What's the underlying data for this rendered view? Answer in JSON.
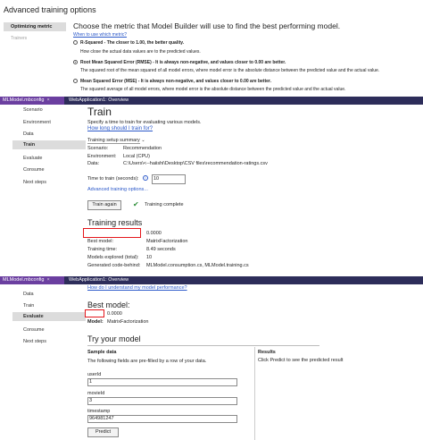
{
  "advanced": {
    "title": "Advanced training options",
    "side_active": "Optimizing metric",
    "side_inactive": "Trainers",
    "heading": "Choose the metric that Model Builder will use to find the best performing model.",
    "link": "When to use which metric?",
    "options": [
      {
        "label": "R-Squared - The closer to 1.00, the better quality.",
        "desc": "How close the actual data values are to the predicted values.",
        "selected": false
      },
      {
        "label": "Root Mean Squared Error (RMSE) - It is always non-negative, and values closer to 0.00 are better.",
        "desc": "The squared root of the mean squared of all model errors, where model error is the absolute distance between the predicted value and the actual value.",
        "selected": true
      },
      {
        "label": "Mean Squared Error (MSE) - It is always non-negative, and values closer to 0.00 are better.",
        "desc": "The squared average of all model errors, where model error is the absolute distance between the predicted value and the actual value.",
        "selected": false
      }
    ]
  },
  "train_panel": {
    "tabs": [
      "MLModel.mbconfig",
      "WebApplication1: Overview"
    ],
    "nav": [
      "Scenario",
      "Environment",
      "Data",
      "Train",
      "Evaluate",
      "Consume",
      "Next steps"
    ],
    "nav_selected": "Train",
    "title": "Train",
    "desc": "Specify a time to train for evaluating various models.",
    "link": "How long should I train for?",
    "summary_title": "Training setup summary",
    "summary_rows": [
      {
        "label": "Scenario:",
        "value": "Recommendation"
      },
      {
        "label": "Environment:",
        "value": "Local (CPU)"
      },
      {
        "label": "Data:",
        "value": "C:\\Users\\<--haiishi\\Desktop\\CSV files\\recommendation-ratings.csv"
      }
    ],
    "time_label": "Time to train (seconds):",
    "time_value": "10",
    "advanced_link": "Advanced training options...",
    "train_again": "Train again",
    "complete": "Training complete",
    "results_title": "Training results",
    "results_value": "0.0000",
    "results_rows": [
      {
        "label": "Best model:",
        "value": "MatrixFactorization"
      },
      {
        "label": "Training time:",
        "value": "8.49 seconds"
      },
      {
        "label": "Models explored (total):",
        "value": "10"
      },
      {
        "label": "Generated code-behind:",
        "value": "MLModel.consumption.cs, MLModel.training.cs"
      }
    ]
  },
  "eval_panel": {
    "tabs": [
      "MLModel.mbconfig",
      "WebApplication1: Overview"
    ],
    "nav": [
      "Data",
      "Train",
      "Evaluate",
      "Consume",
      "Next steps"
    ],
    "nav_selected": "Evaluate",
    "link": "How do I understand my model performance?",
    "best_title": "Best model:",
    "best_value": "0.0000",
    "model_label": "Model:",
    "model_value": "MatrixFactorization",
    "try_title": "Try your model",
    "sample_title": "Sample data",
    "sample_desc": "The following fields are pre-filled by a row of your data.",
    "fields": [
      {
        "label": "userId",
        "value": "1"
      },
      {
        "label": "movieId",
        "value": "3"
      },
      {
        "label": "timestamp",
        "value": "964981247"
      }
    ],
    "predict": "Predict",
    "results_title": "Results",
    "results_desc": "Click Predict to see the predicted result"
  }
}
